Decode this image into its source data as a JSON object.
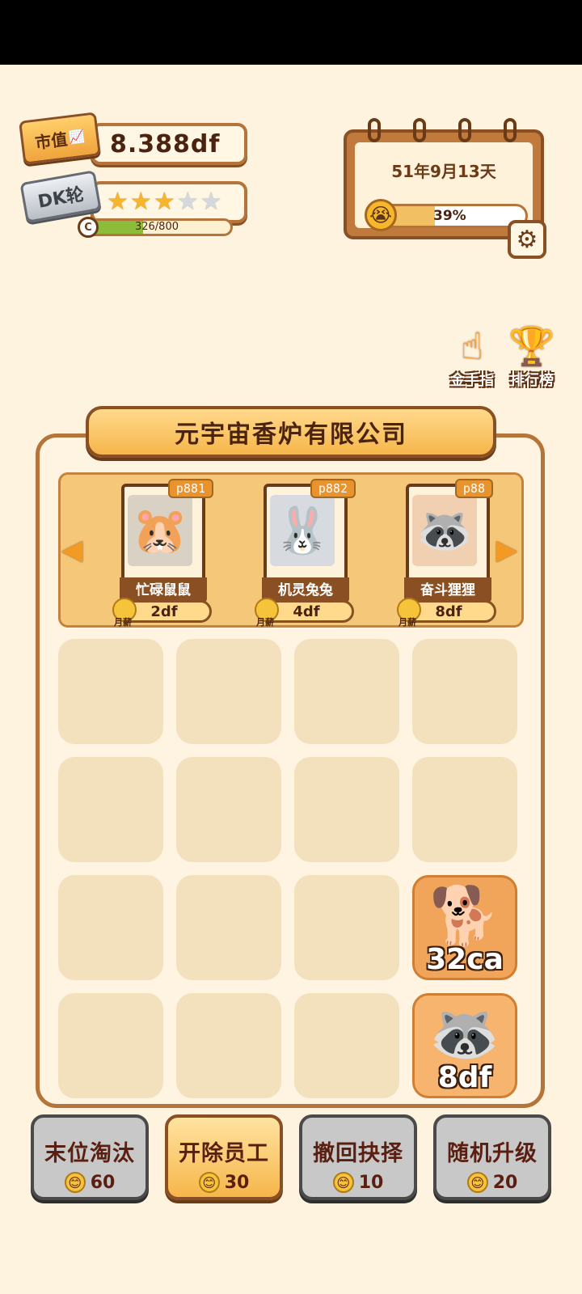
{
  "stats": {
    "market_value_label": "市值",
    "market_value": "8.388df",
    "rank_label": "DK轮",
    "stars_total": 5,
    "stars_filled": 3,
    "xp_badge": "C",
    "xp_text": "326/800",
    "xp_current": 326,
    "xp_max": 800
  },
  "calendar": {
    "date": "51年9月13天",
    "mood_percent_text": "39%",
    "mood_percent": 39,
    "mood_icon": "crying-face-icon"
  },
  "side_buttons": [
    {
      "label": "金手指",
      "icon": "pointing-hand-icon"
    },
    {
      "label": "排行榜",
      "icon": "trophy-icon"
    }
  ],
  "company": {
    "name": "元宇宙香炉有限公司"
  },
  "roster": [
    {
      "code": "p881",
      "name": "忙碌鼠鼠",
      "salary": "2df",
      "salary_label": "月薪",
      "icon": "hamster-icon"
    },
    {
      "code": "p882",
      "name": "机灵兔兔",
      "salary": "4df",
      "salary_label": "月薪",
      "icon": "rabbit-icon"
    },
    {
      "code": "p88",
      "name": "奋斗狸狸",
      "salary": "8df",
      "salary_label": "月薪",
      "icon": "red-panda-icon"
    }
  ],
  "grid": [
    {
      "level": "",
      "icon": ""
    },
    {
      "level": "",
      "icon": ""
    },
    {
      "level": "",
      "icon": ""
    },
    {
      "level": "",
      "icon": ""
    },
    {
      "level": "",
      "icon": ""
    },
    {
      "level": "",
      "icon": ""
    },
    {
      "level": "",
      "icon": ""
    },
    {
      "level": "",
      "icon": ""
    },
    {
      "level": "",
      "icon": ""
    },
    {
      "level": "",
      "icon": ""
    },
    {
      "level": "",
      "icon": ""
    },
    {
      "level": "32ca",
      "icon": "shiba-dog-icon"
    },
    {
      "level": "",
      "icon": ""
    },
    {
      "level": "",
      "icon": ""
    },
    {
      "level": "",
      "icon": ""
    },
    {
      "level": "8df",
      "icon": "red-panda-icon"
    }
  ],
  "actions": [
    {
      "label": "末位淘汰",
      "cost": "60",
      "active": false
    },
    {
      "label": "开除员工",
      "cost": "30",
      "active": true
    },
    {
      "label": "撤回抉择",
      "cost": "10",
      "active": false
    },
    {
      "label": "随机升级",
      "cost": "20",
      "active": false
    }
  ]
}
